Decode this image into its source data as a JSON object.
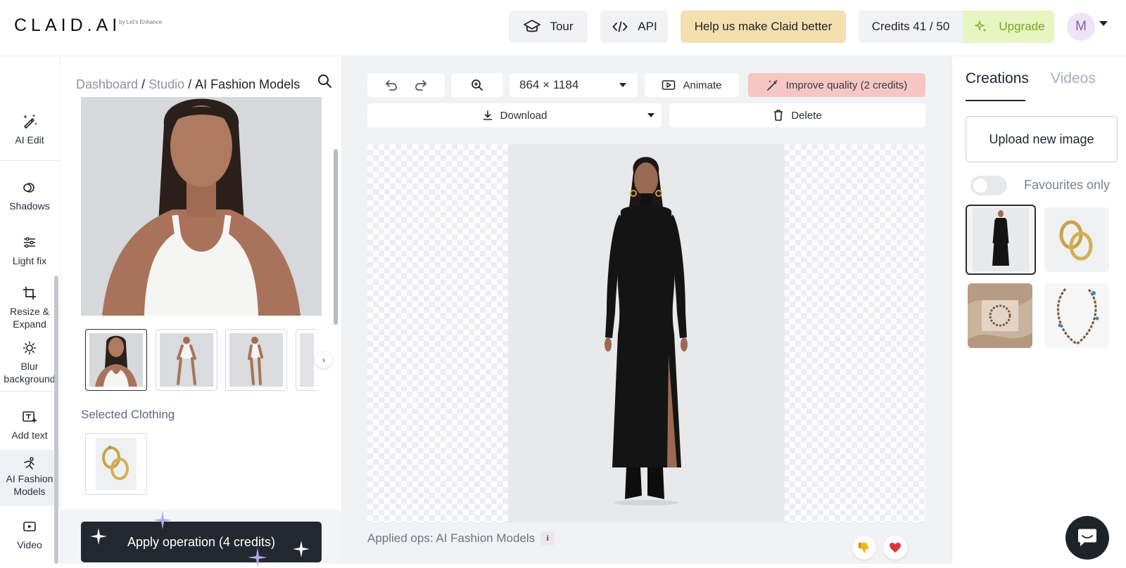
{
  "header": {
    "logo": "CLAID.AI",
    "logo_sub": "by Let's Enhance",
    "tour_label": "Tour",
    "api_label": "API",
    "help_label": "Help us make Claid better",
    "credits_label": "Credits 41 / 50",
    "upgrade_label": "Upgrade",
    "avatar_initial": "M"
  },
  "tools": [
    {
      "label": "AI Edit",
      "icon": "magic-edit-icon"
    },
    {
      "label": "Shadows",
      "icon": "shadows-icon"
    },
    {
      "label": "Light fix",
      "icon": "sliders-icon"
    },
    {
      "label": "Resize & Expand",
      "icon": "crop-icon"
    },
    {
      "label": "Blur background",
      "icon": "blur-icon"
    },
    {
      "label": "Add text",
      "icon": "add-text-icon"
    },
    {
      "label": "AI Fashion Models",
      "icon": "fashion-model-icon",
      "active": true
    },
    {
      "label": "Video",
      "icon": "video-icon"
    }
  ],
  "breadcrumb": {
    "dashboard": "Dashboard",
    "studio": "Studio",
    "current": "AI Fashion Models",
    "separator": "/"
  },
  "panel": {
    "selected_clothing_label": "Selected Clothing",
    "apply_label": "Apply operation (4 credits)"
  },
  "toolbar": {
    "size_label": "864 × 1184",
    "animate_label": "Animate",
    "improve_label": "Improve quality (2 credits)",
    "download_label": "Download",
    "delete_label": "Delete"
  },
  "canvas": {
    "applied_ops": "Applied ops: AI Fashion Models"
  },
  "right_panel": {
    "tabs": [
      "Creations",
      "Videos"
    ],
    "upload_label": "Upload new image",
    "favourites_label": "Favourites only"
  },
  "colors": {
    "help_bg": "#f4dfb1",
    "upgrade_bg": "#e7f5c2",
    "upgrade_text": "#7ea323",
    "improve_bg": "#f6c6c4",
    "apply_bg": "#23272f"
  }
}
